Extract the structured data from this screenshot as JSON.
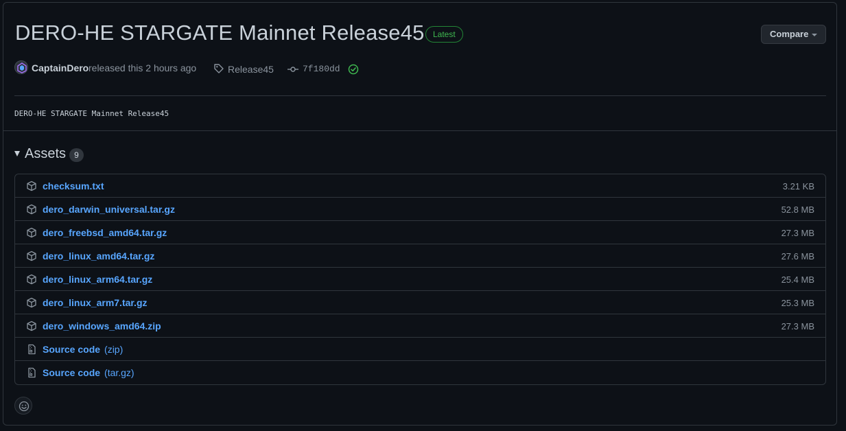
{
  "release": {
    "title": "DERO-HE STARGATE Mainnet Release45",
    "badge": "Latest",
    "compare_label": "Compare"
  },
  "meta": {
    "author": "CaptainDero",
    "released_text": "released this 2 hours ago",
    "tag": "Release45",
    "commit": "7f180dd"
  },
  "description": "DERO-HE STARGATE Mainnet Release45",
  "assets": {
    "title": "Assets",
    "count": "9",
    "items": [
      {
        "name": "checksum.txt",
        "suffix": "",
        "size": "3.21 KB",
        "icon": "package-icon"
      },
      {
        "name": "dero_darwin_universal.tar.gz",
        "suffix": "",
        "size": "52.8 MB",
        "icon": "package-icon"
      },
      {
        "name": "dero_freebsd_amd64.tar.gz",
        "suffix": "",
        "size": "27.3 MB",
        "icon": "package-icon"
      },
      {
        "name": "dero_linux_amd64.tar.gz",
        "suffix": "",
        "size": "27.6 MB",
        "icon": "package-icon"
      },
      {
        "name": "dero_linux_arm64.tar.gz",
        "suffix": "",
        "size": "25.4 MB",
        "icon": "package-icon"
      },
      {
        "name": "dero_linux_arm7.tar.gz",
        "suffix": "",
        "size": "25.3 MB",
        "icon": "package-icon"
      },
      {
        "name": "dero_windows_amd64.zip",
        "suffix": "",
        "size": "27.3 MB",
        "icon": "package-icon"
      },
      {
        "name": "Source code",
        "suffix": "(zip)",
        "size": "",
        "icon": "file-zip-icon"
      },
      {
        "name": "Source code",
        "suffix": "(tar.gz)",
        "size": "",
        "icon": "file-zip-icon"
      }
    ]
  },
  "colors": {
    "background": "#0d1117",
    "border": "#30363d",
    "link": "#58a6ff",
    "muted": "#8b949e",
    "success": "#3fb950"
  }
}
